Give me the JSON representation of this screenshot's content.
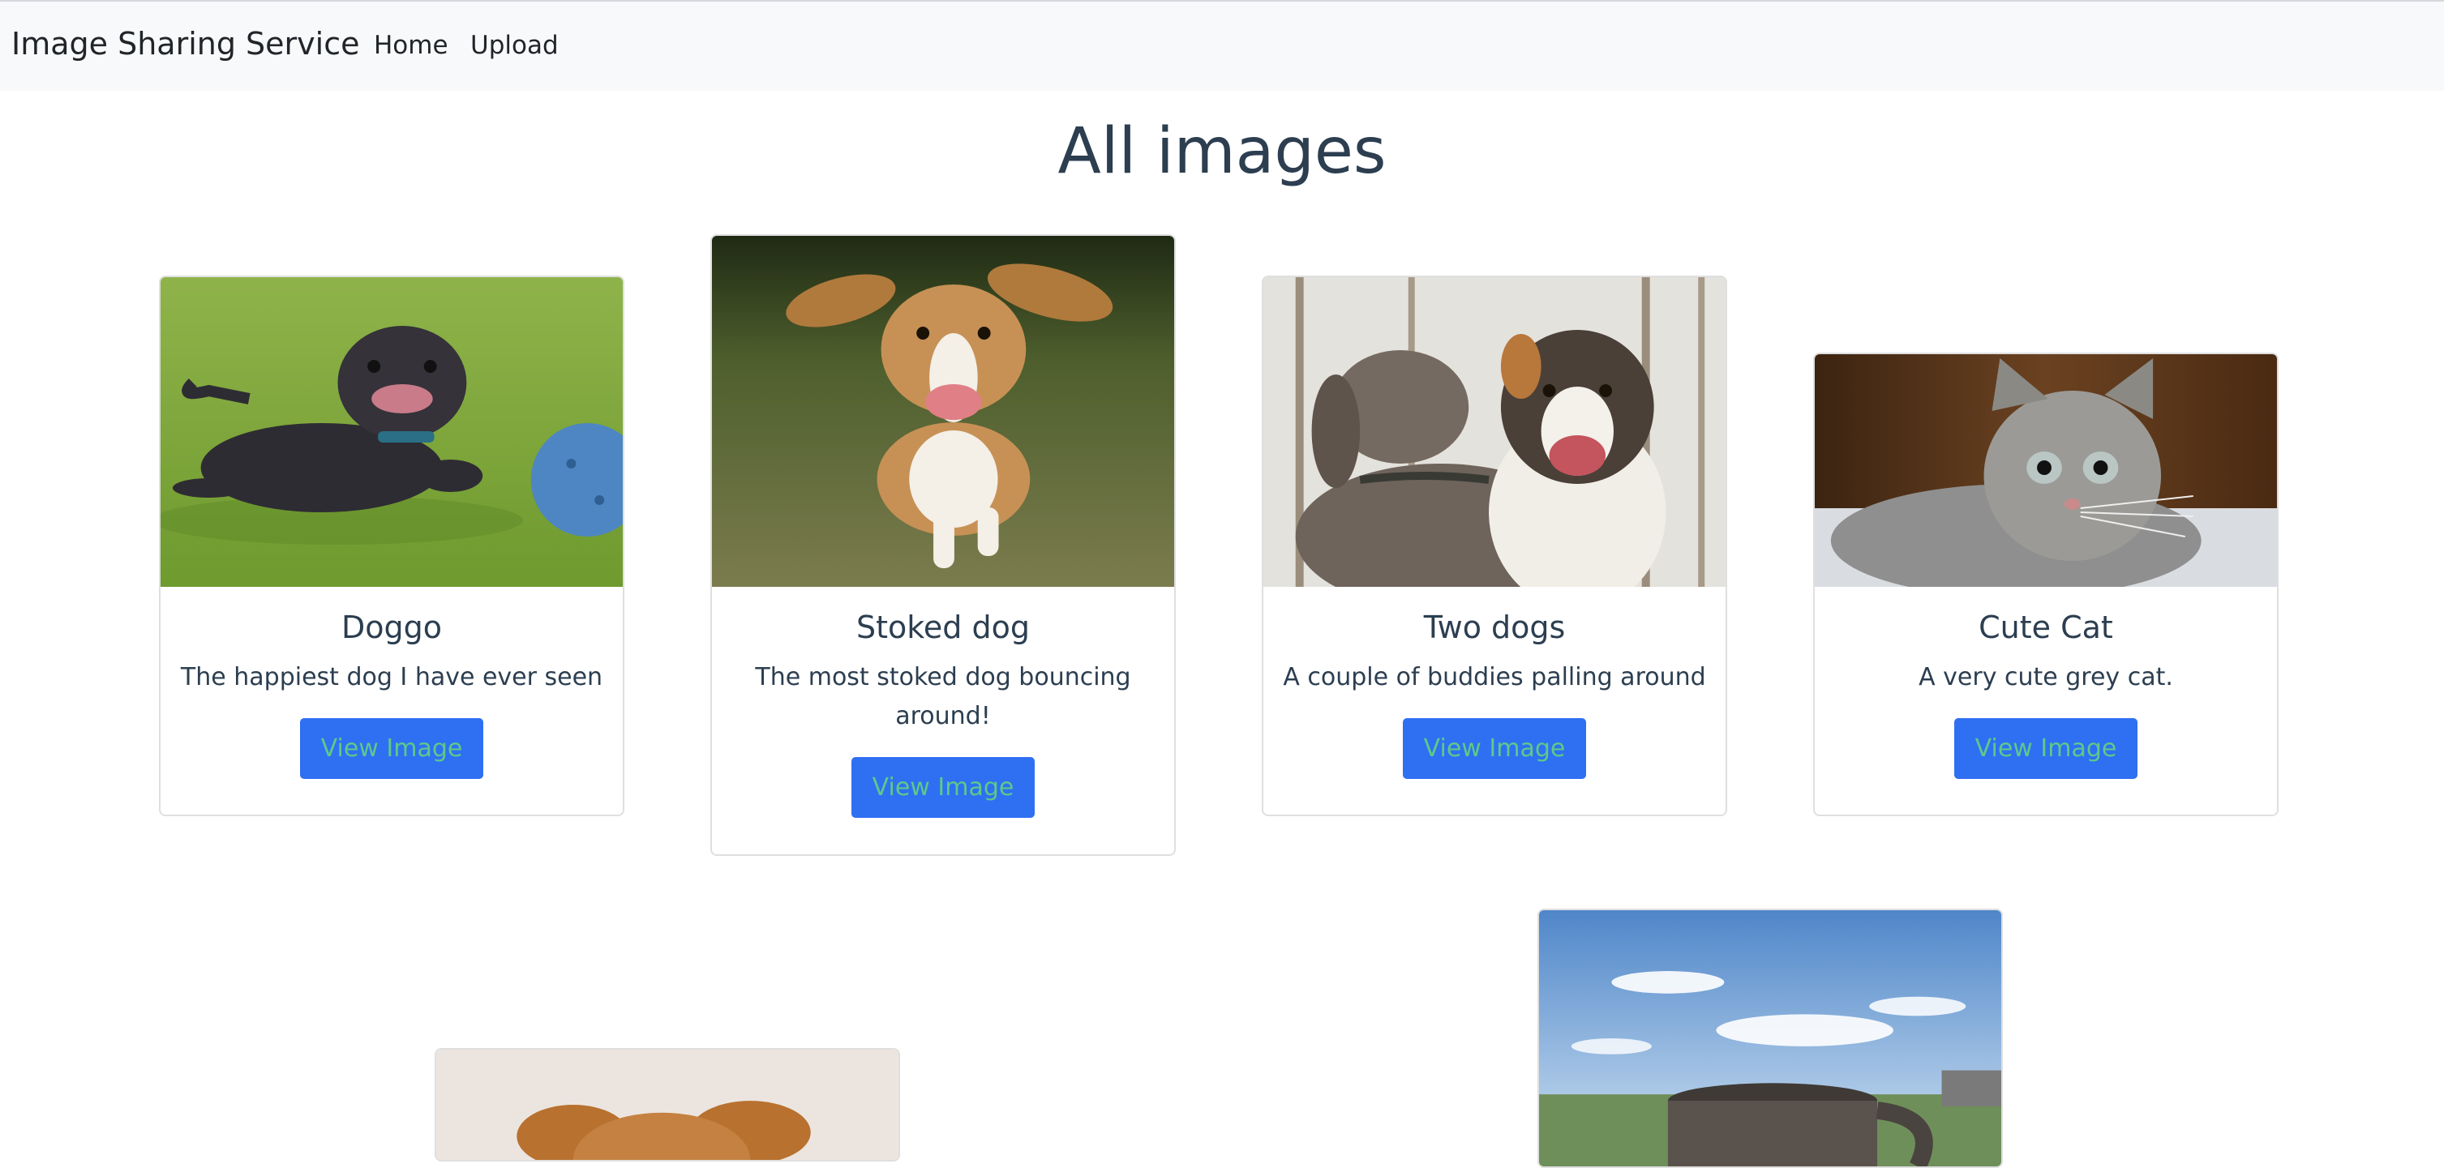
{
  "navbar": {
    "brand": "Image Sharing Service",
    "links": [
      {
        "label": "Home"
      },
      {
        "label": "Upload"
      }
    ]
  },
  "page": {
    "title": "All images"
  },
  "cards": [
    {
      "title": "Doggo",
      "text": "The happiest dog I have ever seen",
      "button": "View Image",
      "image_icon": "dog-photo"
    },
    {
      "title": "Stoked dog",
      "text": "The most stoked dog bouncing around!",
      "button": "View Image",
      "image_icon": "dog-photo"
    },
    {
      "title": "Two dogs",
      "text": "A couple of buddies palling around",
      "button": "View Image",
      "image_icon": "dogs-photo"
    },
    {
      "title": "Cute Cat",
      "text": "A very cute grey cat.",
      "button": "View Image",
      "image_icon": "cat-photo"
    },
    {
      "image_icon": "dog-photo"
    },
    {
      "image_icon": "mug-photo"
    }
  ],
  "colors": {
    "navbar_bg": "#f8f9fa",
    "button_bg": "#2f6ff2",
    "button_text": "#5cc98a",
    "heading_text": "#2c3e50"
  }
}
